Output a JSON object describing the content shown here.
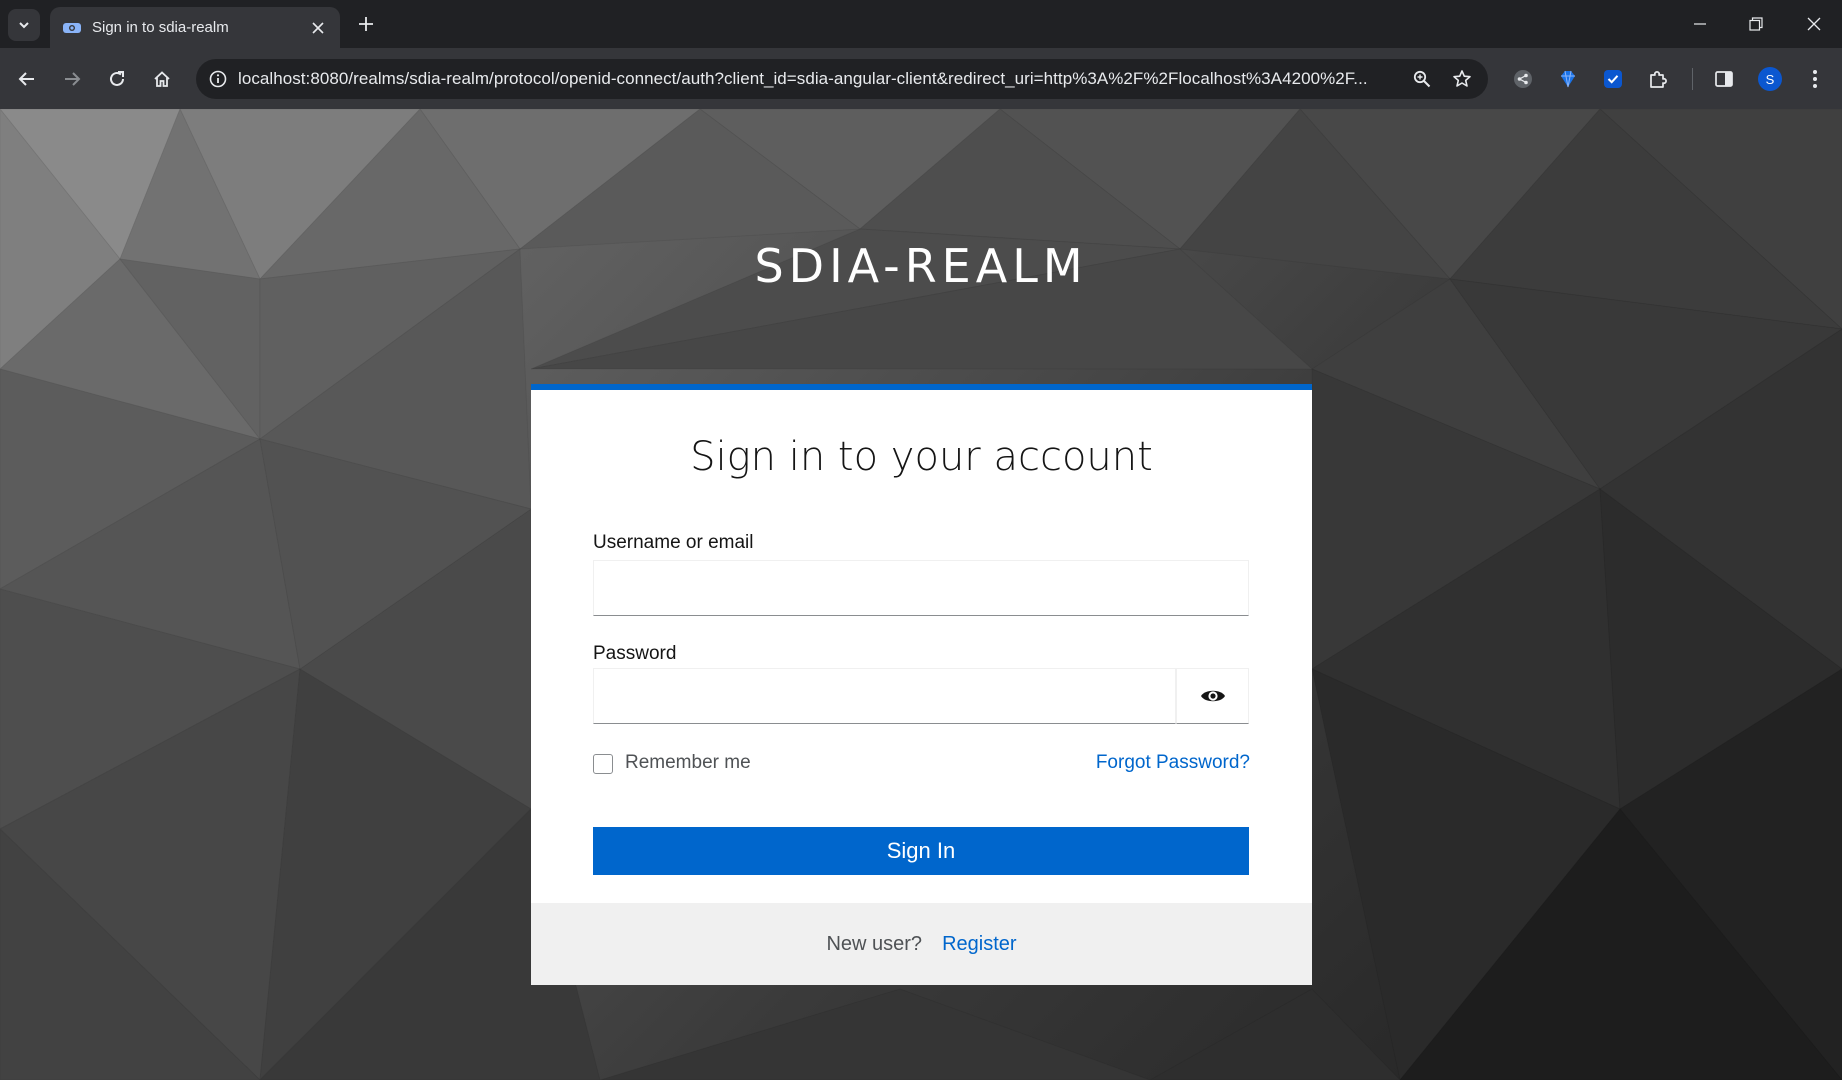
{
  "browser": {
    "tab_title": "Sign in to sdia-realm",
    "url": "localhost:8080/realms/sdia-realm/protocol/openid-connect/auth?client_id=sdia-angular-client&redirect_uri=http%3A%2F%2Flocalhost%3A4200%2F...",
    "profile_initial": "S",
    "icons": [
      "tab-search-icon",
      "new-tab-icon",
      "minimize-icon",
      "restore-icon",
      "close-window-icon",
      "back-icon",
      "forward-icon",
      "reload-icon",
      "home-icon",
      "site-info-icon",
      "zoom-icon",
      "bookmark-star-icon",
      "extension-share-icon",
      "extension-diamond-icon",
      "extension-check-icon",
      "extensions-puzzle-icon",
      "side-panel-icon",
      "menu-kebab-icon"
    ]
  },
  "page": {
    "realm_title": "SDIA-REALM",
    "card_title": "Sign in to your account",
    "username_label": "Username or email",
    "username_value": "",
    "password_label": "Password",
    "password_value": "",
    "remember_label": "Remember me",
    "remember_checked": false,
    "forgot_link": "Forgot Password?",
    "signin_button": "Sign In",
    "new_user_text": "New user?",
    "register_link": "Register"
  },
  "colors": {
    "accent": "#0066cc",
    "footer_bg": "#f0f0f0",
    "chrome_dark": "#202124",
    "chrome_toolbar": "#35363a"
  }
}
